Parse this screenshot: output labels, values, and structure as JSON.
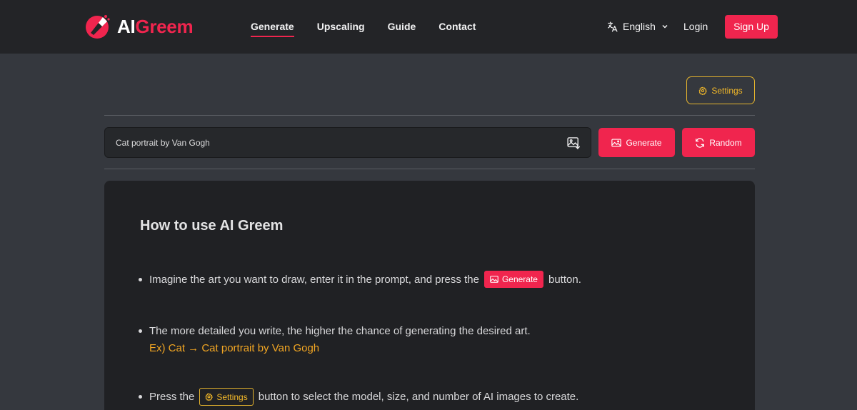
{
  "brand": {
    "ai": "AI",
    "greem": "Greem",
    "accent": "#f0254e"
  },
  "nav": {
    "items": [
      {
        "label": "Generate",
        "active": true
      },
      {
        "label": "Upscaling",
        "active": false
      },
      {
        "label": "Guide",
        "active": false
      },
      {
        "label": "Contact",
        "active": false
      }
    ],
    "language": "English",
    "login": "Login",
    "signup": "Sign Up"
  },
  "toolbar": {
    "settings_label": "Settings",
    "settings_color": "#f2b829"
  },
  "prompt": {
    "value": "Cat portrait by Van Gogh",
    "placeholder": ""
  },
  "actions": {
    "generate_label": "Generate",
    "random_label": "Random"
  },
  "guide": {
    "title": "How to use AI Greem",
    "step1_before": "Imagine the art you want to draw, enter it in the prompt, and press the",
    "step1_button": "Generate",
    "step1_after": "button.",
    "step2": "The more detailed you write, the higher the chance of generating the desired art.",
    "step2_example": "Ex) Cat → Cat portrait by Van Gogh",
    "step3_before": "Press the",
    "step3_button": "Settings",
    "step3_after": "button to select the model, size, and number of AI images to create."
  },
  "icons": [
    "logo-icon",
    "translate-icon",
    "chevron-down-icon",
    "gear-icon",
    "image-upload-icon",
    "image-icon",
    "refresh-icon"
  ]
}
